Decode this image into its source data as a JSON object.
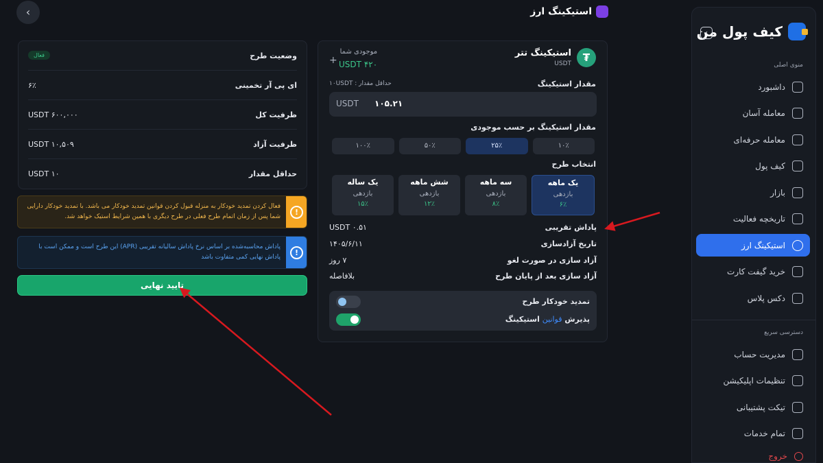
{
  "header": {
    "title": "استیکینگ ارز",
    "back_icon": "chevron-left-icon"
  },
  "sidebar": {
    "brand": "کیف پول من",
    "main_menu_title": "منوی اصلی",
    "items": [
      {
        "label": "داشبورد",
        "icon": "grid-icon"
      },
      {
        "label": "معامله آسان",
        "icon": "exchange-icon"
      },
      {
        "label": "معامله حرفه‌ای",
        "icon": "coins-icon"
      },
      {
        "label": "کیف پول",
        "icon": "wallet-icon"
      },
      {
        "label": "بازار",
        "icon": "chart-icon"
      },
      {
        "label": "تاریخچه فعالیت",
        "icon": "calendar-icon"
      },
      {
        "label": "استیکینگ ارز",
        "icon": "staking-icon",
        "active": true
      },
      {
        "label": "خرید گیفت کارت",
        "icon": "gift-icon"
      },
      {
        "label": "دکس پلاس",
        "icon": "swap-icon"
      }
    ],
    "quick_access_title": "دسترسی سریع",
    "quick_items": [
      {
        "label": "مدیریت حساب",
        "icon": "id-card-icon"
      },
      {
        "label": "تنظیمات اپلیکیشن",
        "icon": "sliders-icon"
      },
      {
        "label": "تیکت پشتیبانی",
        "icon": "support-24-icon"
      },
      {
        "label": "تمام خدمات",
        "icon": "apps-icon"
      },
      {
        "label": "خروج",
        "icon": "logout-icon"
      }
    ]
  },
  "staking": {
    "coin_name": "استیکینگ تتر",
    "coin_symbol": "USDT",
    "balance_label": "موجودی شما",
    "balance_value": "۴۲۰ USDT",
    "amount_label": "مقدار استیکینگ",
    "min_amount": "حداقل مقدار : ۱۰USDT",
    "amount_value": "۱۰۵.۲۱",
    "amount_unit": "USDT",
    "by_balance_label": "مقدار استیکینگ بر حسب موجودی",
    "percent_options": [
      "۱۰۰٪",
      "۵۰٪",
      "۲۵٪",
      "۱۰٪"
    ],
    "plan_label": "انتخاب طرح",
    "plans": [
      {
        "name": "یک ساله",
        "return_label": "بازدهی",
        "rate": "۱۵٪"
      },
      {
        "name": "شش ماهه",
        "return_label": "بازدهی",
        "rate": "۱۲٪"
      },
      {
        "name": "سه ماهه",
        "return_label": "بازدهی",
        "rate": "۸٪"
      },
      {
        "name": "یک ماهه",
        "return_label": "بازدهی",
        "rate": "۶٪"
      }
    ],
    "details": [
      {
        "key": "پاداش تقریبی",
        "value": "۰.۵۱ USDT"
      },
      {
        "key": "تاریخ آزادسازی",
        "value": "۱۴۰۵/۶/۱۱"
      },
      {
        "key": "آزاد سازی در صورت لغو",
        "value": "۷ روز"
      },
      {
        "key": "آزاد سازی بعد از پایان طرح",
        "value": "بلافاصله"
      }
    ],
    "auto_renew_label": "تمدید خودکار طرح",
    "accept_prefix": "پذیرش",
    "accept_link": "قوانین",
    "accept_suffix": "استیکینگ"
  },
  "summary": {
    "rows": [
      {
        "key": "وضعیت طرح",
        "badge": "فعال"
      },
      {
        "key": "ای پی آر تخمینی",
        "value": "۶٪"
      },
      {
        "key": "ظرفیت کل",
        "value": "۶۰۰,۰۰۰ USDT"
      },
      {
        "key": "ظرفیت آزاد",
        "value": "۱۰,۵۰۹ USDT"
      },
      {
        "key": "حداقل مقدار",
        "value": "۱۰ USDT"
      }
    ]
  },
  "alerts": {
    "warning": "فعال کردن تمدید خودکار به منزله قبول کردن قوانین تمدید خودکار می باشد. با تمدید خودکار دارایی شما پس از زمان اتمام طرح فعلی در طرح دیگری با همین شرایط استیک خواهد شد.",
    "info": "پاداش محاسبه‌شده بر اساس نرخ پاداش سالیانه تقریبی (APR) این طرح است و ممکن است با پاداش نهایی کمی متفاوت باشد"
  },
  "confirm_label": "تایید نهایی",
  "colors": {
    "accent": "#2f6fec",
    "success": "#18a56b",
    "warning": "#f5a623",
    "info": "#2f7de1",
    "annotation_arrow": "#d7191f"
  }
}
